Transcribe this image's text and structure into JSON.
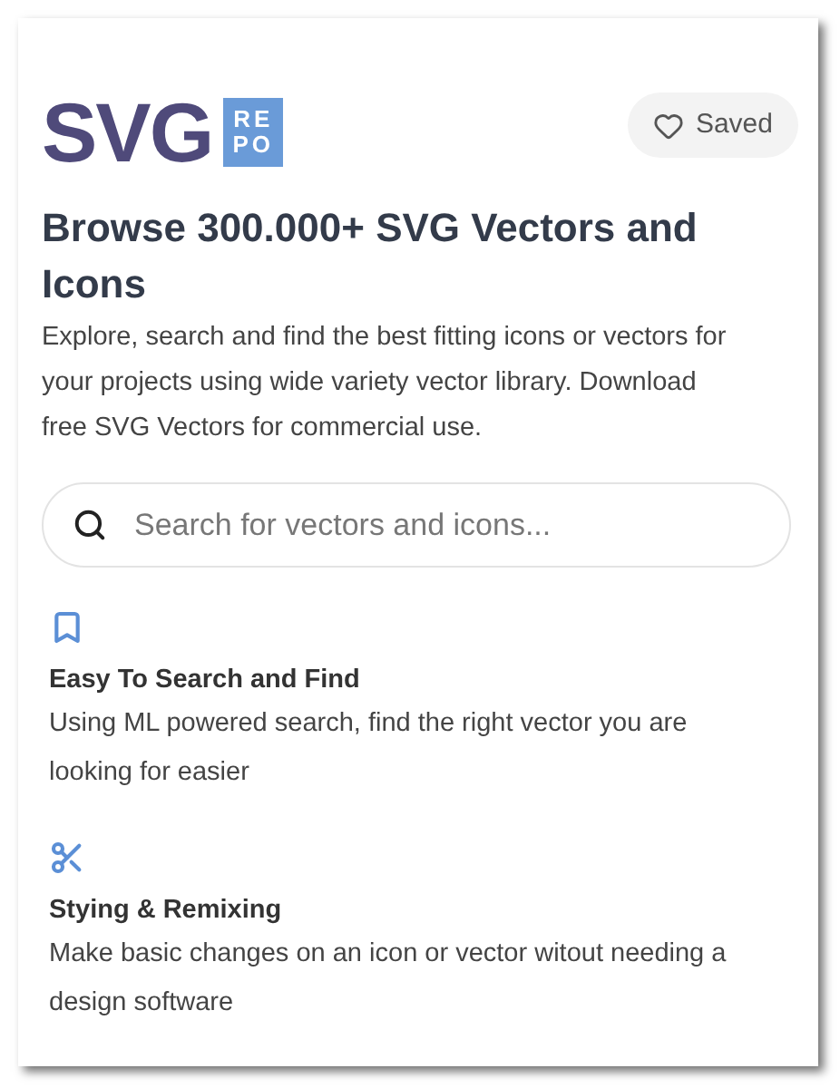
{
  "logo": {
    "word": "SVG",
    "badge_top": "RE",
    "badge_bottom": "PO"
  },
  "saved_button": {
    "label": "Saved"
  },
  "heading": "Browse 300.000+ SVG Vectors and Icons",
  "description": "Explore, search and find the best fitting icons or vectors for your projects using wide variety vector library. Download free SVG Vectors for commercial use.",
  "search": {
    "placeholder": "Search for vectors and icons..."
  },
  "features": [
    {
      "kind": "bookmark",
      "title": "Easy To Search and Find",
      "text": "Using ML powered search, find the right vector you are looking for easier"
    },
    {
      "kind": "scissors",
      "title": "Stying & Remixing",
      "text": "Make basic changes on an icon or vector witout needing a design software"
    }
  ]
}
